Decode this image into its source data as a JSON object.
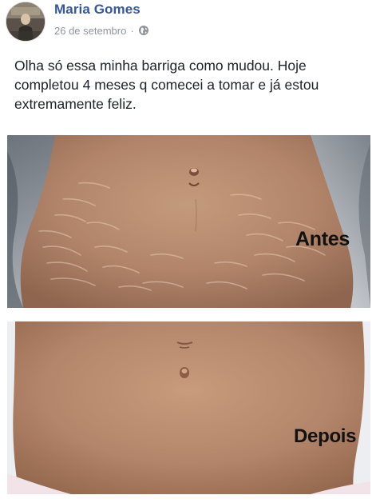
{
  "post": {
    "author": "Maria Gomes",
    "date": "26 de setembro",
    "separator": "·",
    "privacy_icon": "globe-icon",
    "caption": "Olha só essa minha barriga como mudou. Hoje completou 4 meses q comecei a tomar e já estou extremamente feliz.",
    "photos": [
      {
        "label": "Antes"
      },
      {
        "label": "Depois"
      }
    ]
  },
  "colors": {
    "author_link": "#365899",
    "meta_text": "#90949c",
    "caption_text": "#1d2129"
  }
}
